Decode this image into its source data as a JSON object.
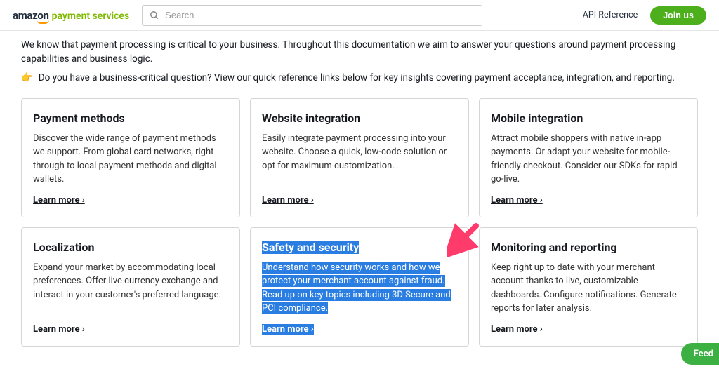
{
  "header": {
    "logo_amazon": "amazon",
    "logo_ps": "payment services",
    "search_placeholder": "Search",
    "api_reference": "API Reference",
    "join_us": "Join us"
  },
  "intro": {
    "line1": "We know that payment processing is critical to your business. Throughout this documentation we aim to answer your questions around payment processing capabilities and business logic.",
    "line2": "Do you have a business-critical question? View our quick reference links below for key insights covering payment acceptance, integration, and reporting."
  },
  "cards": [
    {
      "title": "Payment methods",
      "desc": "Discover the wide range of payment methods we support. From global card networks, right through to local payment methods and digital wallets.",
      "learn": "Learn more ›"
    },
    {
      "title": "Website integration",
      "desc": "Easily integrate payment processing into your website. Choose a quick, low-code solution or opt for maximum customization.",
      "learn": "Learn more ›"
    },
    {
      "title": "Mobile integration",
      "desc": "Attract mobile shoppers with native in-app payments. Or adapt your website for mobile-friendly checkout. Consider our SDKs for rapid go-live.",
      "learn": "Learn more ›"
    },
    {
      "title": "Localization",
      "desc": "Expand your market by accommodating local preferences. Offer live currency exchange and interact in your customer's preferred language.",
      "learn": "Learn more ›"
    },
    {
      "title": "Safety and security",
      "desc": "Understand how security works and how we protect your merchant account against fraud. Read up on key topics including 3D Secure and PCI compliance.",
      "learn": "Learn more ›"
    },
    {
      "title": "Monitoring and reporting",
      "desc": "Keep right up to date with your merchant account thanks to live, customizable dashboards. Configure notifications. Generate reports for later analysis.",
      "learn": "Learn more ›"
    }
  ],
  "feed_tab": "Feed"
}
